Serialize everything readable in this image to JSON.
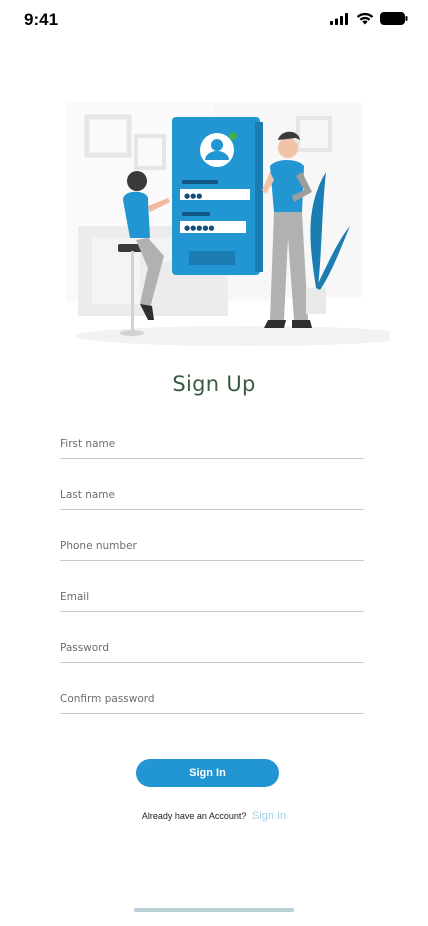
{
  "status_bar": {
    "time": "9:41"
  },
  "illustration": {
    "password_dots_top": "●●●",
    "password_dots_bottom": "●●●●●"
  },
  "page": {
    "title": "Sign Up"
  },
  "form": {
    "first_name_placeholder": "First name",
    "last_name_placeholder": "Last name",
    "phone_placeholder": "Phone number",
    "email_placeholder": "Email",
    "password_placeholder": "Password",
    "confirm_password_placeholder": "Confirm password"
  },
  "actions": {
    "signin_button_label": "Sign In",
    "account_prompt": "Already have an Account?",
    "account_link": "Sign In"
  },
  "colors": {
    "accent": "#2196d3",
    "title": "#3c5a3f",
    "link": "#9fd1e6"
  }
}
